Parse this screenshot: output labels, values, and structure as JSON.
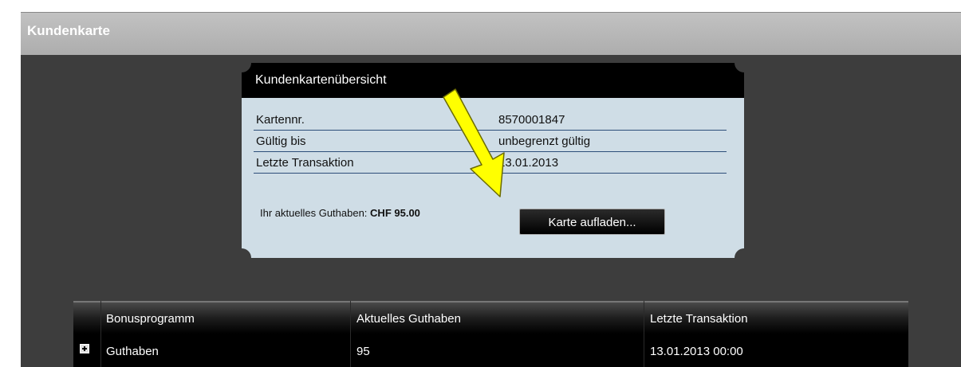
{
  "section": {
    "title": "Kundenkarte"
  },
  "overview": {
    "title": "Kundenkartenübersicht",
    "rows": [
      {
        "label": "Kartennr.",
        "value": "8570001847"
      },
      {
        "label": "Gültig bis",
        "value": "unbegrenzt gültig"
      },
      {
        "label": "Letzte Transaktion",
        "value": "13.01.2013"
      }
    ],
    "balance_label": "Ihr aktuelles Guthaben:",
    "balance_amount": "CHF 95.00",
    "topup_button": "Karte aufladen..."
  },
  "annotation": {
    "arrow_color": "#ffff00",
    "arrow_icon": "arrow-pointer-icon"
  },
  "table": {
    "headers": [
      "Bonusprogramm",
      "Aktuelles Guthaben",
      "Letzte Transaktion"
    ],
    "rows": [
      {
        "expand_icon": "plus-box-icon",
        "program": "Guthaben",
        "balance": "95",
        "last_transaction": "13.01.2013 00:00"
      }
    ]
  }
}
